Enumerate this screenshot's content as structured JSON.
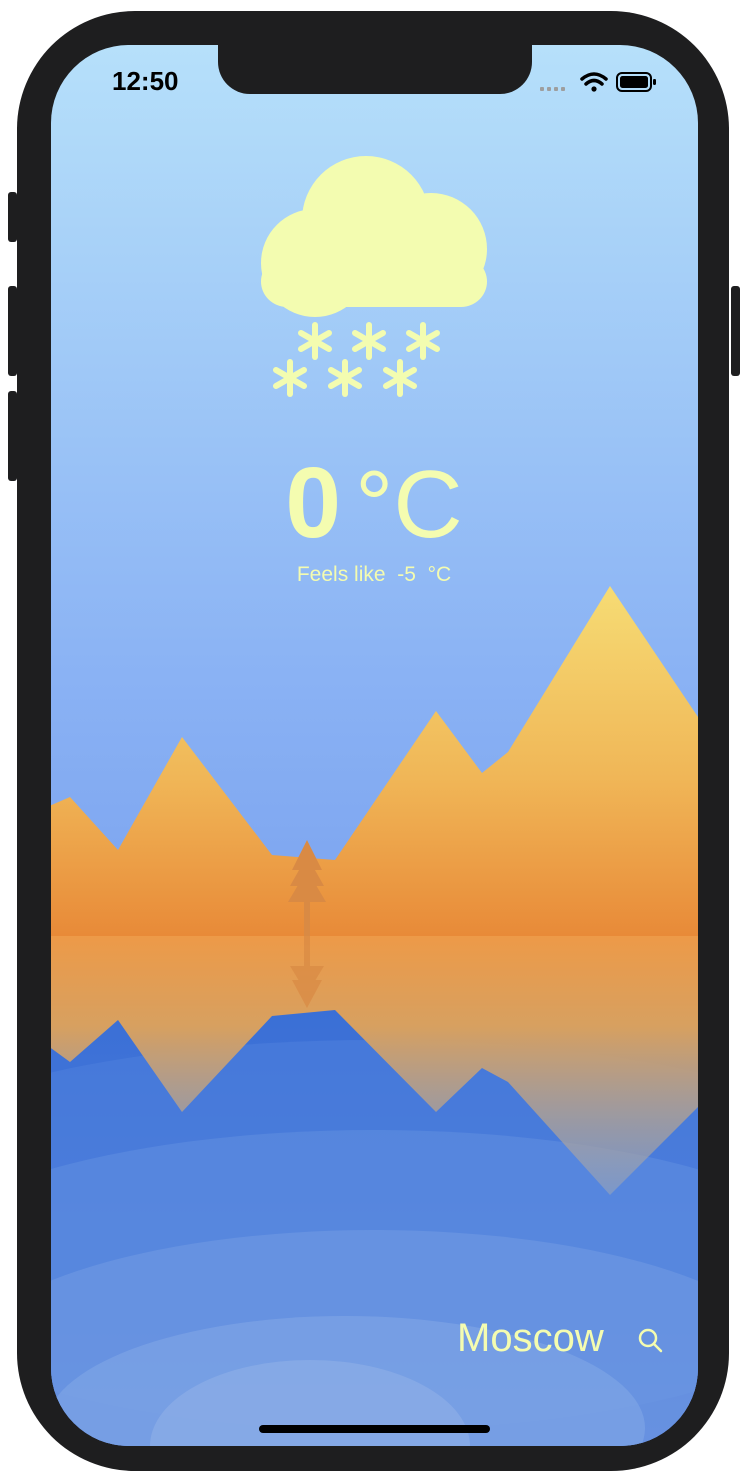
{
  "status_bar": {
    "time": "12:50",
    "icons": [
      "signal-icon",
      "wifi-icon",
      "battery-icon"
    ]
  },
  "weather": {
    "condition_icon": "snow-cloud-icon",
    "temperature": "0",
    "unit": "°C",
    "feels_like_label": "Feels like",
    "feels_like_value": "-5",
    "feels_like_unit": "°C"
  },
  "location": {
    "city": "Moscow",
    "search_icon": "search-icon"
  },
  "colors": {
    "accent_text": "#f4fcb0",
    "sky_top": "#b6e0fa",
    "sky_bottom": "#7aa2ef",
    "mountain_top": "#f6dc74",
    "mountain_bottom": "#e88a38",
    "water": "#3a6fd6"
  }
}
